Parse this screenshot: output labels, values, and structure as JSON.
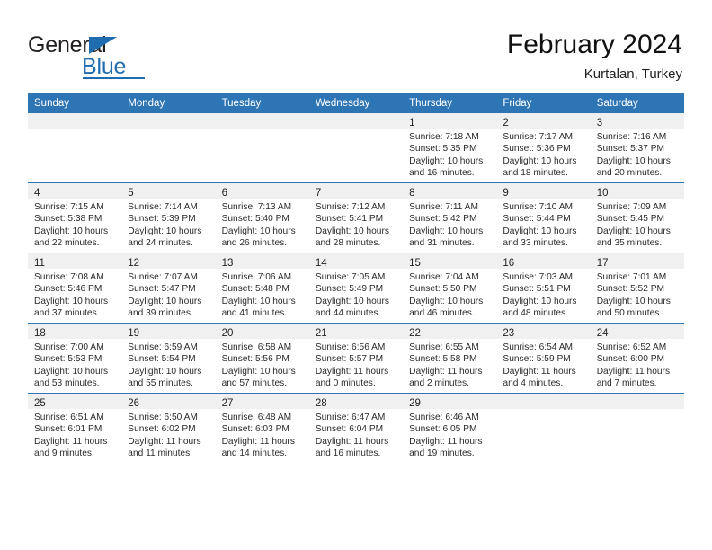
{
  "brand": {
    "name_part1": "General",
    "name_part2": "Blue",
    "logo_icon": "triangle-flag-icon",
    "accent_color": "#1f6cb0"
  },
  "header": {
    "title": "February 2024",
    "location": "Kurtalan, Turkey"
  },
  "calendar": {
    "header_bg": "#2e75b6",
    "daynum_strip_bg": "#f0f0f0",
    "weekday_headers": [
      "Sunday",
      "Monday",
      "Tuesday",
      "Wednesday",
      "Thursday",
      "Friday",
      "Saturday"
    ],
    "weeks": [
      [
        {
          "day": "",
          "sunrise": "",
          "sunset": "",
          "daylight_line1": "",
          "daylight_line2": "",
          "empty": true
        },
        {
          "day": "",
          "sunrise": "",
          "sunset": "",
          "daylight_line1": "",
          "daylight_line2": "",
          "empty": true
        },
        {
          "day": "",
          "sunrise": "",
          "sunset": "",
          "daylight_line1": "",
          "daylight_line2": "",
          "empty": true
        },
        {
          "day": "",
          "sunrise": "",
          "sunset": "",
          "daylight_line1": "",
          "daylight_line2": "",
          "empty": true
        },
        {
          "day": "1",
          "sunrise": "Sunrise: 7:18 AM",
          "sunset": "Sunset: 5:35 PM",
          "daylight_line1": "Daylight: 10 hours",
          "daylight_line2": "and 16 minutes."
        },
        {
          "day": "2",
          "sunrise": "Sunrise: 7:17 AM",
          "sunset": "Sunset: 5:36 PM",
          "daylight_line1": "Daylight: 10 hours",
          "daylight_line2": "and 18 minutes."
        },
        {
          "day": "3",
          "sunrise": "Sunrise: 7:16 AM",
          "sunset": "Sunset: 5:37 PM",
          "daylight_line1": "Daylight: 10 hours",
          "daylight_line2": "and 20 minutes."
        }
      ],
      [
        {
          "day": "4",
          "sunrise": "Sunrise: 7:15 AM",
          "sunset": "Sunset: 5:38 PM",
          "daylight_line1": "Daylight: 10 hours",
          "daylight_line2": "and 22 minutes."
        },
        {
          "day": "5",
          "sunrise": "Sunrise: 7:14 AM",
          "sunset": "Sunset: 5:39 PM",
          "daylight_line1": "Daylight: 10 hours",
          "daylight_line2": "and 24 minutes."
        },
        {
          "day": "6",
          "sunrise": "Sunrise: 7:13 AM",
          "sunset": "Sunset: 5:40 PM",
          "daylight_line1": "Daylight: 10 hours",
          "daylight_line2": "and 26 minutes."
        },
        {
          "day": "7",
          "sunrise": "Sunrise: 7:12 AM",
          "sunset": "Sunset: 5:41 PM",
          "daylight_line1": "Daylight: 10 hours",
          "daylight_line2": "and 28 minutes."
        },
        {
          "day": "8",
          "sunrise": "Sunrise: 7:11 AM",
          "sunset": "Sunset: 5:42 PM",
          "daylight_line1": "Daylight: 10 hours",
          "daylight_line2": "and 31 minutes."
        },
        {
          "day": "9",
          "sunrise": "Sunrise: 7:10 AM",
          "sunset": "Sunset: 5:44 PM",
          "daylight_line1": "Daylight: 10 hours",
          "daylight_line2": "and 33 minutes."
        },
        {
          "day": "10",
          "sunrise": "Sunrise: 7:09 AM",
          "sunset": "Sunset: 5:45 PM",
          "daylight_line1": "Daylight: 10 hours",
          "daylight_line2": "and 35 minutes."
        }
      ],
      [
        {
          "day": "11",
          "sunrise": "Sunrise: 7:08 AM",
          "sunset": "Sunset: 5:46 PM",
          "daylight_line1": "Daylight: 10 hours",
          "daylight_line2": "and 37 minutes."
        },
        {
          "day": "12",
          "sunrise": "Sunrise: 7:07 AM",
          "sunset": "Sunset: 5:47 PM",
          "daylight_line1": "Daylight: 10 hours",
          "daylight_line2": "and 39 minutes."
        },
        {
          "day": "13",
          "sunrise": "Sunrise: 7:06 AM",
          "sunset": "Sunset: 5:48 PM",
          "daylight_line1": "Daylight: 10 hours",
          "daylight_line2": "and 41 minutes."
        },
        {
          "day": "14",
          "sunrise": "Sunrise: 7:05 AM",
          "sunset": "Sunset: 5:49 PM",
          "daylight_line1": "Daylight: 10 hours",
          "daylight_line2": "and 44 minutes."
        },
        {
          "day": "15",
          "sunrise": "Sunrise: 7:04 AM",
          "sunset": "Sunset: 5:50 PM",
          "daylight_line1": "Daylight: 10 hours",
          "daylight_line2": "and 46 minutes."
        },
        {
          "day": "16",
          "sunrise": "Sunrise: 7:03 AM",
          "sunset": "Sunset: 5:51 PM",
          "daylight_line1": "Daylight: 10 hours",
          "daylight_line2": "and 48 minutes."
        },
        {
          "day": "17",
          "sunrise": "Sunrise: 7:01 AM",
          "sunset": "Sunset: 5:52 PM",
          "daylight_line1": "Daylight: 10 hours",
          "daylight_line2": "and 50 minutes."
        }
      ],
      [
        {
          "day": "18",
          "sunrise": "Sunrise: 7:00 AM",
          "sunset": "Sunset: 5:53 PM",
          "daylight_line1": "Daylight: 10 hours",
          "daylight_line2": "and 53 minutes."
        },
        {
          "day": "19",
          "sunrise": "Sunrise: 6:59 AM",
          "sunset": "Sunset: 5:54 PM",
          "daylight_line1": "Daylight: 10 hours",
          "daylight_line2": "and 55 minutes."
        },
        {
          "day": "20",
          "sunrise": "Sunrise: 6:58 AM",
          "sunset": "Sunset: 5:56 PM",
          "daylight_line1": "Daylight: 10 hours",
          "daylight_line2": "and 57 minutes."
        },
        {
          "day": "21",
          "sunrise": "Sunrise: 6:56 AM",
          "sunset": "Sunset: 5:57 PM",
          "daylight_line1": "Daylight: 11 hours",
          "daylight_line2": "and 0 minutes."
        },
        {
          "day": "22",
          "sunrise": "Sunrise: 6:55 AM",
          "sunset": "Sunset: 5:58 PM",
          "daylight_line1": "Daylight: 11 hours",
          "daylight_line2": "and 2 minutes."
        },
        {
          "day": "23",
          "sunrise": "Sunrise: 6:54 AM",
          "sunset": "Sunset: 5:59 PM",
          "daylight_line1": "Daylight: 11 hours",
          "daylight_line2": "and 4 minutes."
        },
        {
          "day": "24",
          "sunrise": "Sunrise: 6:52 AM",
          "sunset": "Sunset: 6:00 PM",
          "daylight_line1": "Daylight: 11 hours",
          "daylight_line2": "and 7 minutes."
        }
      ],
      [
        {
          "day": "25",
          "sunrise": "Sunrise: 6:51 AM",
          "sunset": "Sunset: 6:01 PM",
          "daylight_line1": "Daylight: 11 hours",
          "daylight_line2": "and 9 minutes."
        },
        {
          "day": "26",
          "sunrise": "Sunrise: 6:50 AM",
          "sunset": "Sunset: 6:02 PM",
          "daylight_line1": "Daylight: 11 hours",
          "daylight_line2": "and 11 minutes."
        },
        {
          "day": "27",
          "sunrise": "Sunrise: 6:48 AM",
          "sunset": "Sunset: 6:03 PM",
          "daylight_line1": "Daylight: 11 hours",
          "daylight_line2": "and 14 minutes."
        },
        {
          "day": "28",
          "sunrise": "Sunrise: 6:47 AM",
          "sunset": "Sunset: 6:04 PM",
          "daylight_line1": "Daylight: 11 hours",
          "daylight_line2": "and 16 minutes."
        },
        {
          "day": "29",
          "sunrise": "Sunrise: 6:46 AM",
          "sunset": "Sunset: 6:05 PM",
          "daylight_line1": "Daylight: 11 hours",
          "daylight_line2": "and 19 minutes."
        },
        {
          "day": "",
          "sunrise": "",
          "sunset": "",
          "daylight_line1": "",
          "daylight_line2": "",
          "empty": true
        },
        {
          "day": "",
          "sunrise": "",
          "sunset": "",
          "daylight_line1": "",
          "daylight_line2": "",
          "empty": true
        }
      ]
    ]
  }
}
